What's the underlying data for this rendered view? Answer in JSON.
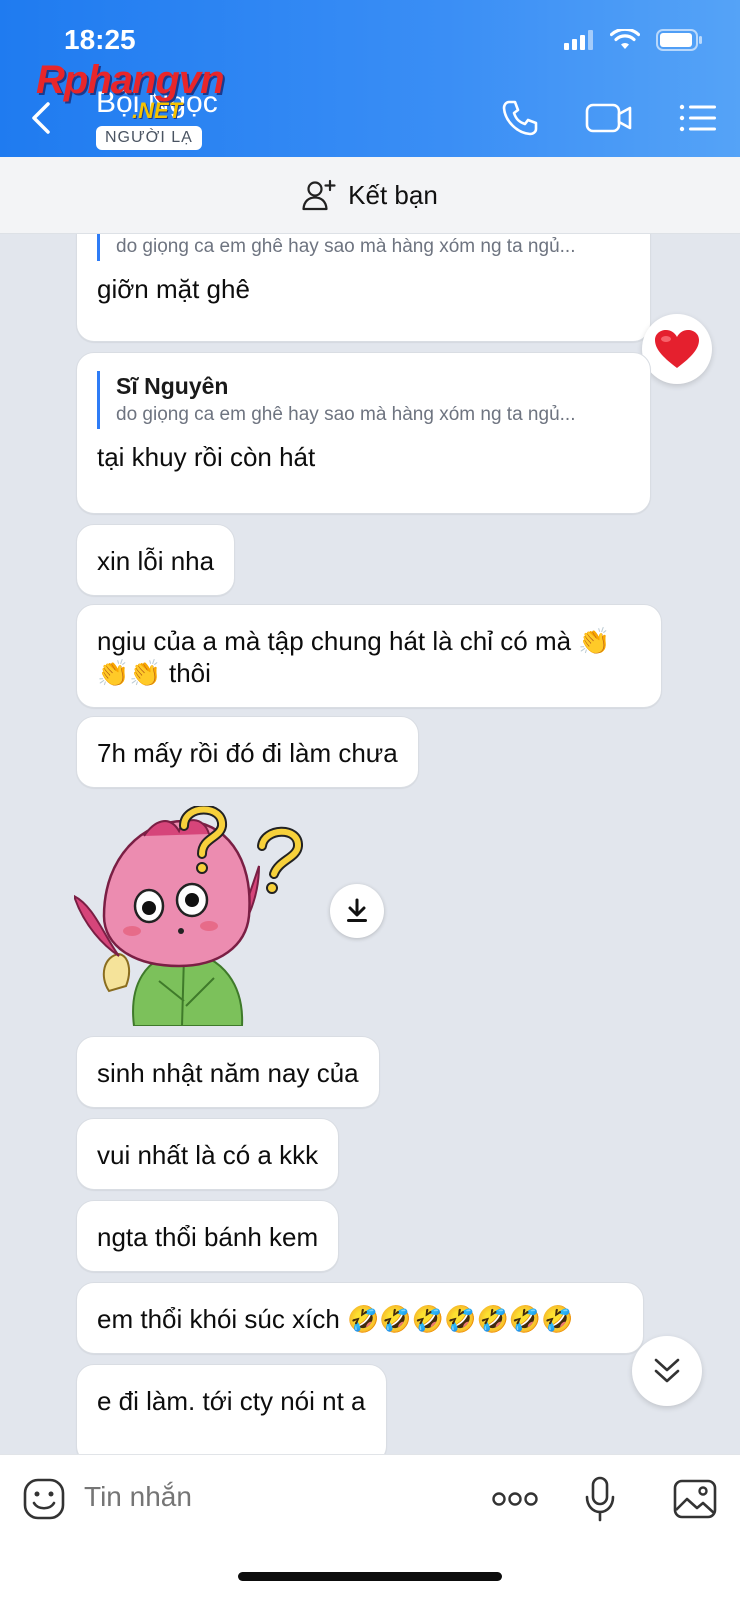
{
  "status": {
    "time": "18:25"
  },
  "watermark": {
    "main": "Rphangvn",
    "sub": ".NET"
  },
  "header": {
    "contact_name": "Bội Ngọc",
    "badge": "NGƯỜI LẠ"
  },
  "friend_bar": {
    "label": "Kết bạn"
  },
  "messages": [
    {
      "quote_text": "do giọng ca em ghê hay sao mà hàng xóm ng ta ngủ...",
      "text": "giỡn mặt ghê"
    },
    {
      "quote_author": "Sĩ Nguyên",
      "quote_text": "do giọng ca em ghê hay sao mà hàng xóm ng ta ngủ...",
      "text": "tại khuy rồi còn hát"
    },
    {
      "text": "xin lỗi nha"
    },
    {
      "text_line1": "ngiu của a mà tập chung hát là chỉ có mà 👏",
      "text_line2": "👏👏 thôi"
    },
    {
      "text": "7h mấy rồi đó đi làm chưa"
    },
    {
      "text": "sinh nhật năm nay của"
    },
    {
      "text": "vui nhất là có a kkk"
    },
    {
      "text": "ngta thổi bánh kem"
    },
    {
      "text": "em thổi khói súc xích 🤣🤣🤣🤣🤣🤣🤣"
    },
    {
      "text": "e đi làm. tới cty nói nt a"
    }
  ],
  "reaction": {
    "icon": "heart-icon",
    "color": "#e5202e"
  },
  "composer": {
    "placeholder": "Tin nhắn"
  },
  "colors": {
    "header_start": "#1f7bf0",
    "header_end": "#55a3f7",
    "quote_bar": "#2e7cf6",
    "chat_bg": "#e2e6ed"
  }
}
